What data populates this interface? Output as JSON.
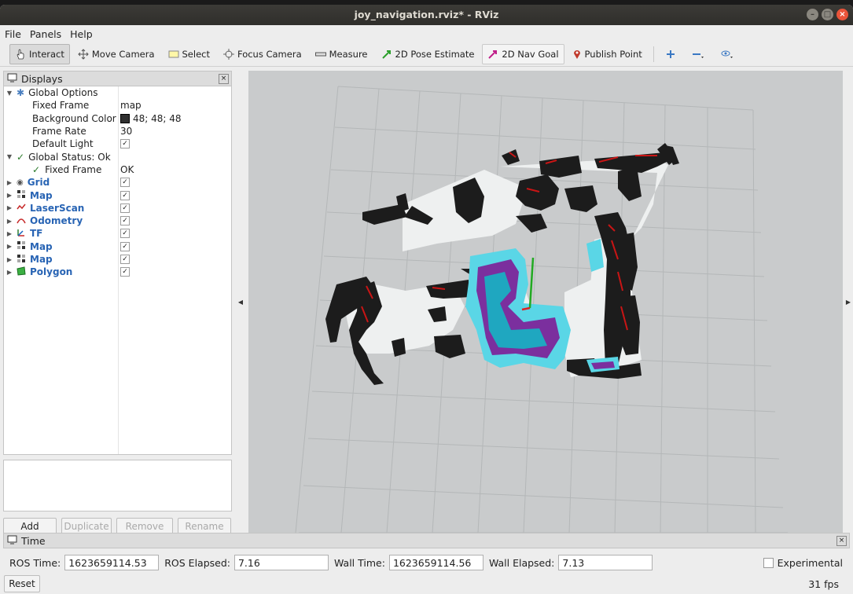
{
  "window": {
    "title": "joy_navigation.rviz* - RViz"
  },
  "menu": [
    "File",
    "Panels",
    "Help"
  ],
  "toolbar": {
    "tools": [
      {
        "label": "Interact",
        "icon": "hand-cursor-icon",
        "active": true
      },
      {
        "label": "Move Camera",
        "icon": "move-camera-icon"
      },
      {
        "label": "Select",
        "icon": "select-icon"
      },
      {
        "label": "Focus Camera",
        "icon": "focus-camera-icon"
      },
      {
        "label": "Measure",
        "icon": "ruler-icon"
      },
      {
        "label": "2D Pose Estimate",
        "icon": "pose-arrow-icon",
        "color": "#2ca02c"
      },
      {
        "label": "2D Nav Goal",
        "icon": "goal-arrow-icon",
        "color": "#c0208a"
      },
      {
        "label": "Publish Point",
        "icon": "map-pin-icon",
        "color": "#c0392b"
      }
    ]
  },
  "displays": {
    "title": "Displays",
    "global_options": {
      "label": "Global Options",
      "fixed_frame_label": "Fixed Frame",
      "fixed_frame_value": "map",
      "background_color_label": "Background Color",
      "background_color_value": "48; 48; 48",
      "frame_rate_label": "Frame Rate",
      "frame_rate_value": "30",
      "default_light_label": "Default Light",
      "default_light_checked": true
    },
    "global_status": {
      "label": "Global Status: Ok",
      "fixed_frame_label": "Fixed Frame",
      "fixed_frame_value": "OK"
    },
    "items": [
      {
        "label": "Grid",
        "icon": "grid-icon",
        "checked": true
      },
      {
        "label": "Map",
        "icon": "map-icon",
        "checked": true
      },
      {
        "label": "LaserScan",
        "icon": "laserscan-icon",
        "checked": true
      },
      {
        "label": "Odometry",
        "icon": "odometry-icon",
        "checked": true
      },
      {
        "label": "TF",
        "icon": "tf-icon",
        "checked": true
      },
      {
        "label": "Map",
        "icon": "map-icon",
        "checked": true
      },
      {
        "label": "Map",
        "icon": "map-icon",
        "checked": true
      },
      {
        "label": "Polygon",
        "icon": "polygon-icon",
        "checked": true
      }
    ],
    "buttons": {
      "add": "Add",
      "duplicate": "Duplicate",
      "remove": "Remove",
      "rename": "Rename"
    }
  },
  "time": {
    "title": "Time",
    "ros_time_label": "ROS Time:",
    "ros_time": "1623659114.53",
    "ros_elapsed_label": "ROS Elapsed:",
    "ros_elapsed": "7.16",
    "wall_time_label": "Wall Time:",
    "wall_time": "1623659114.56",
    "wall_elapsed_label": "Wall Elapsed:",
    "wall_elapsed": "7.13",
    "experimental_label": "Experimental",
    "reset_label": "Reset",
    "fps": "31 fps"
  }
}
